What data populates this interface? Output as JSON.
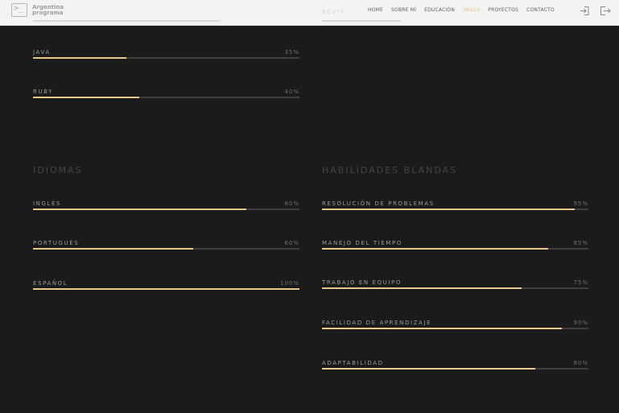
{
  "header": {
    "logo_line1": "Argentina",
    "logo_line2": "programa",
    "nav": [
      "HOME",
      "SOBRE MÍ",
      "EDUCACIÓN",
      "SKILLS",
      "PROYECTOS",
      "CONTACTO"
    ],
    "active_nav": "SKILLS",
    "icons": [
      "login-icon",
      "logout-icon"
    ],
    "hidden_partial_label": "REVIT"
  },
  "tech_skills": [
    {
      "label": "JAVA",
      "percent_label": "35%",
      "value": 35
    },
    {
      "label": "RUBY",
      "percent_label": "40%",
      "value": 40
    }
  ],
  "idiomas": {
    "title": "IDIOMAS",
    "items": [
      {
        "label": "INGLÉS",
        "percent_label": "80%",
        "value": 80
      },
      {
        "label": "PORTUGUÉS",
        "percent_label": "60%",
        "value": 60
      },
      {
        "label": "ESPAÑOL",
        "percent_label": "100%",
        "value": 100
      }
    ]
  },
  "blandas": {
    "title": "HABILIDADES BLANDAS",
    "items": [
      {
        "label": "RESOLUCIÓN DE PROBLEMAS",
        "percent_label": "95%",
        "value": 95
      },
      {
        "label": "MANEJO DEL TIEMPO",
        "percent_label": "85%",
        "value": 85
      },
      {
        "label": "TRABAJO EN EQUIPO",
        "percent_label": "75%",
        "value": 75
      },
      {
        "label": "FACILIDAD DE APRENDIZAJE",
        "percent_label": "90%",
        "value": 90
      },
      {
        "label": "ADAPTABILIDAD",
        "percent_label": "80%",
        "value": 80
      }
    ]
  },
  "colors": {
    "accent": "#e8c68e",
    "track": "#3e3e3e",
    "background": "#1b1b1b"
  }
}
